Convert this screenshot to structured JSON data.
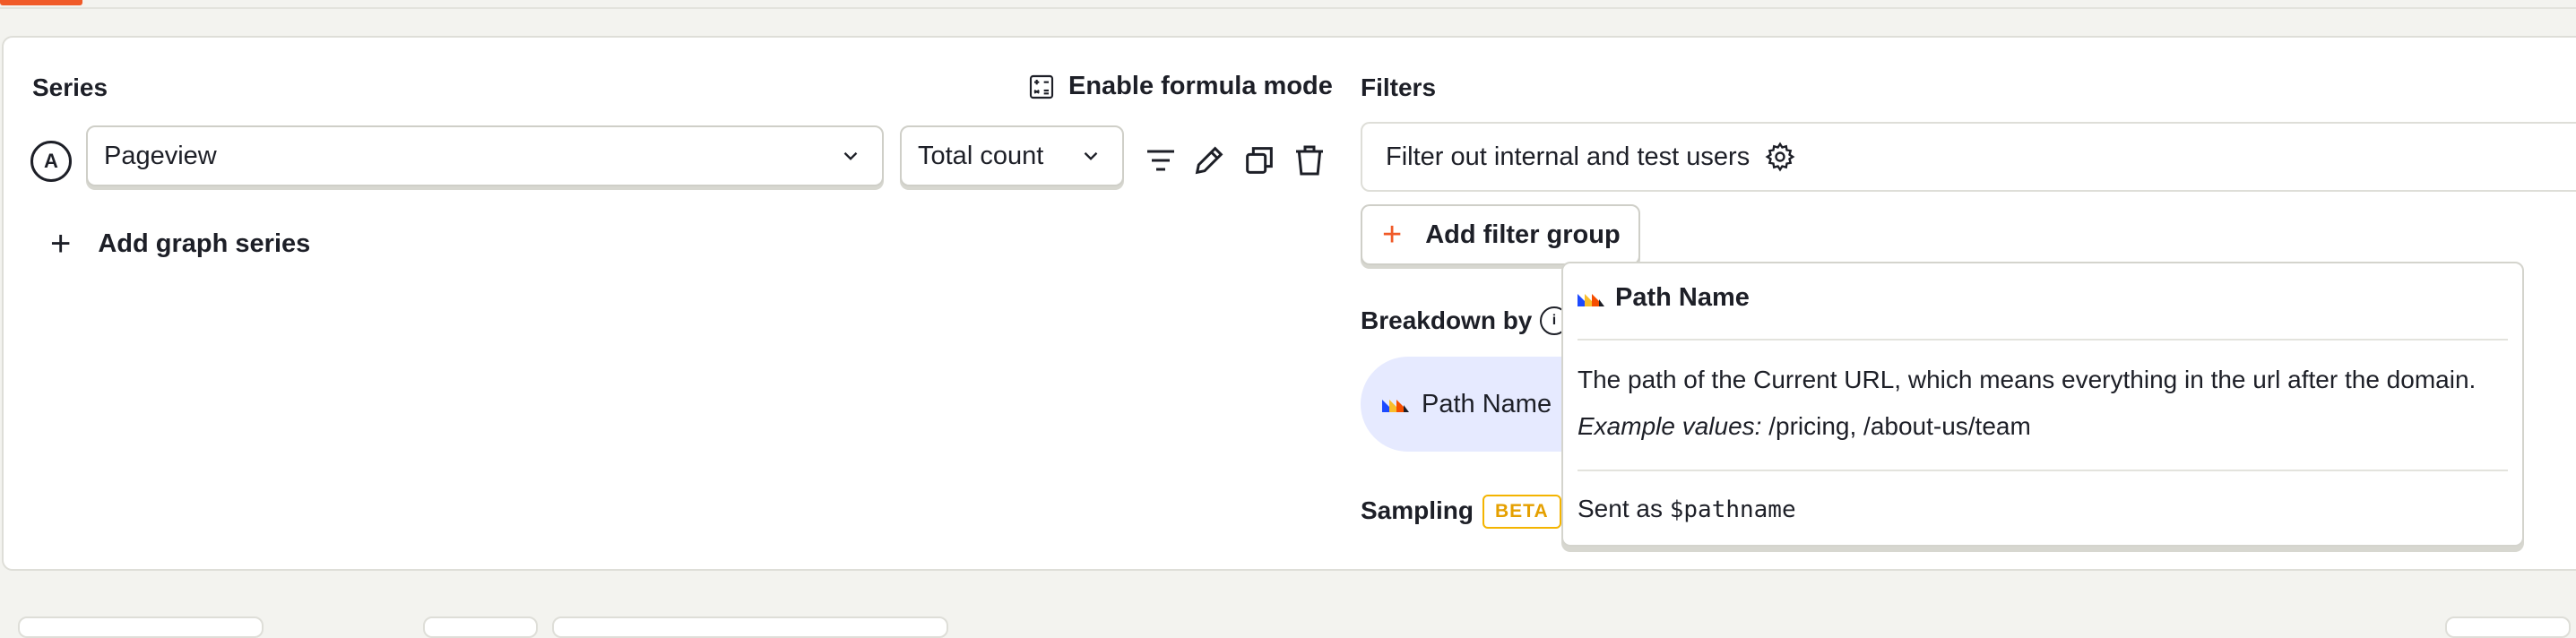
{
  "colors": {
    "accent": "#f05a28",
    "beta": "#e5a000",
    "pill_bg": "#e6eaff"
  },
  "series": {
    "heading": "Series",
    "formula_toggle_label": "Enable formula mode",
    "letter": "A",
    "event_select": {
      "value": "Pageview",
      "icon": "chevron-down-icon"
    },
    "math_select": {
      "value": "Total count",
      "icon": "chevron-down-icon"
    },
    "row_actions": [
      "filter-icon",
      "pencil-icon",
      "duplicate-icon",
      "trash-icon"
    ],
    "add_series_label": "Add graph series"
  },
  "filters": {
    "heading": "Filters",
    "internal_filter_label": "Filter out internal and test users",
    "add_group_label": "Add filter group"
  },
  "breakdown": {
    "heading": "Breakdown by",
    "info_glyph": "i",
    "pill_label": "Path Name"
  },
  "sampling": {
    "heading": "Sampling",
    "badge": "BETA"
  },
  "tooltip": {
    "title": "Path Name",
    "description": "The path of the Current URL, which means everything in the url after the domain.",
    "examples_label": "Example values:",
    "examples_value": " /pricing, /about-us/team",
    "sent_as_prefix": "Sent as ",
    "sent_as_code": "$pathname"
  }
}
